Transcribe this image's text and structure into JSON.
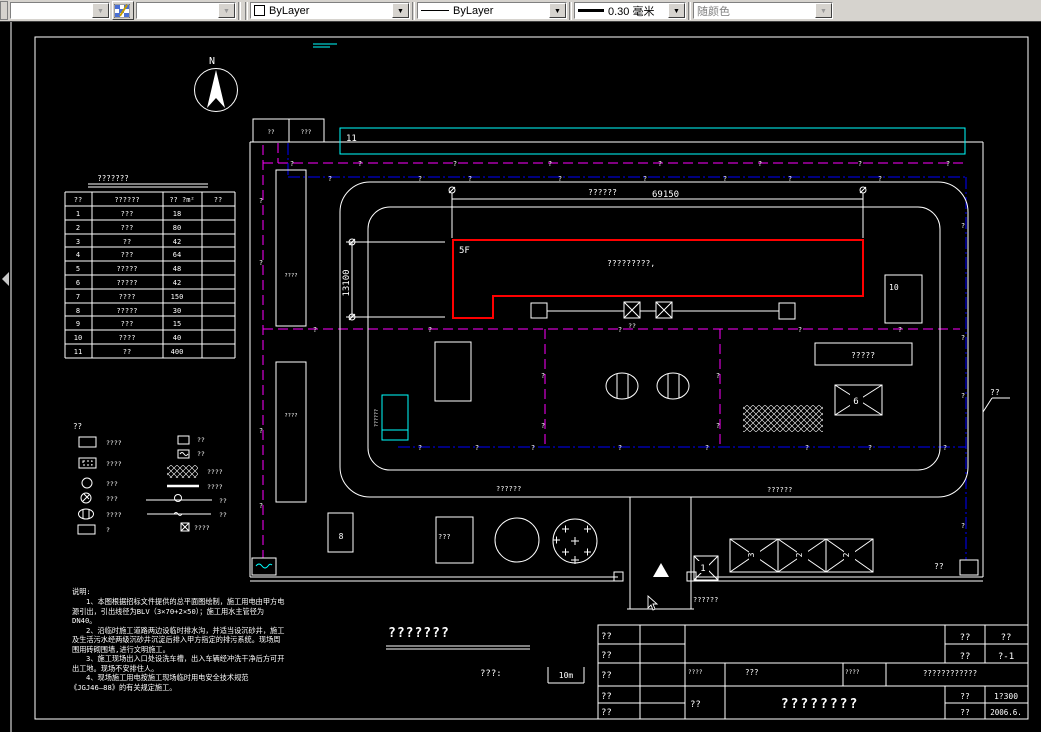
{
  "toolbar": {
    "combo1_value": "",
    "combo2_value": "",
    "color_value": "ByLayer",
    "linetype_value": "ByLayer",
    "lineweight_value": "0.30 毫米",
    "plotstyle_value": "随颜色"
  },
  "colors": {
    "canvas_background": "#000000",
    "drawing_line": "#ffffff",
    "building_outline": "#ff0000",
    "water_pipe_line": "#ff00ff",
    "power_cable_line": "#0000ff",
    "highlight": "#00ffff",
    "toolbar_background": "#d6d3ce"
  },
  "site_table": {
    "title": "???????",
    "headers": [
      "??",
      "??????",
      "?? ?m²",
      "??"
    ],
    "rows": [
      {
        "no": "1",
        "name": "???",
        "area": "18",
        "note": ""
      },
      {
        "no": "2",
        "name": "???",
        "area": "80",
        "note": ""
      },
      {
        "no": "3",
        "name": "??",
        "area": "42",
        "note": ""
      },
      {
        "no": "4",
        "name": "???",
        "area": "64",
        "note": ""
      },
      {
        "no": "5",
        "name": "?????",
        "area": "48",
        "note": ""
      },
      {
        "no": "6",
        "name": "?????",
        "area": "42",
        "note": ""
      },
      {
        "no": "7",
        "name": "????",
        "area": "150",
        "note": ""
      },
      {
        "no": "8",
        "name": "?????",
        "area": "30",
        "note": ""
      },
      {
        "no": "9",
        "name": "???",
        "area": "15",
        "note": ""
      },
      {
        "no": "10",
        "name": "????",
        "area": "40",
        "note": ""
      },
      {
        "no": "11",
        "name": "??",
        "area": "400",
        "note": ""
      }
    ]
  },
  "legend": {
    "title": "??",
    "left": [
      {
        "icon": "rect-outline",
        "label": "????"
      },
      {
        "icon": "rect-dashed-inner",
        "label": "????"
      },
      {
        "icon": "circle-crosshatch",
        "label": "???"
      },
      {
        "icon": "circle-diagonal",
        "label": "???"
      },
      {
        "icon": "ellipse-bars",
        "label": "????"
      },
      {
        "icon": "brick-rect",
        "label": "?"
      }
    ],
    "right": [
      {
        "icon": "hatch-box",
        "label": "??"
      },
      {
        "icon": "wave-box",
        "label": "??"
      },
      {
        "icon": "hatch-area",
        "label": "????"
      },
      {
        "icon": "thick-line",
        "label": "????"
      },
      {
        "icon": "line-circle",
        "label": "??"
      },
      {
        "icon": "line-wave",
        "label": "??"
      },
      {
        "icon": "x-box",
        "label": "????"
      }
    ]
  },
  "plan": {
    "north": "N",
    "box_a": "??",
    "box_b": "???",
    "strip_label": "11",
    "left_bldg1": "????",
    "left_bldg2": "????",
    "dim_road_label": "??????",
    "dim_road_value": "69150",
    "dim_left_value": "13100",
    "bldg_floor": "5F",
    "bldg_name": "?????????,",
    "xbox_label": "??",
    "store_label": "?????",
    "box6": "6",
    "box10": "10",
    "tank_label": "??????",
    "road_label1": "??????",
    "road_label2": "??????",
    "box8": "8",
    "box_small": "???",
    "gate_label": "??????",
    "box1": "1",
    "crane_cells": [
      "3",
      "2",
      "2"
    ],
    "power_label": "??",
    "fence_label": "??",
    "pipe_marker": "?"
  },
  "notes": {
    "lines": [
      "说明:",
      "1、本图根据招标文件提供的总平面图绘制，施工用电由甲方电",
      "源引出，引出线径为BLV（3×70+2×50）；施工用水主管径为",
      "DN40。",
      "2、沿临时施工道路两边设临时排水沟，并适当设沉砂井，施工",
      "及生活污水经两级沉砂井沉淀后排入甲方指定的排污系统。现场周",
      "围用砖砌围墙,进行文明施工。",
      "3、施工现场出入口处设洗车槽，出入车辆经冲洗干净后方可开",
      "出工地。现场不安排住人。",
      "4、现场施工用电按施工现场临时用电安全技术规范",
      "《JGJ46—88》的有关规定施工。"
    ]
  },
  "drawing_title": {
    "text": "???????",
    "scale_label": "???:",
    "bar_label": "10m"
  },
  "title_block": {
    "rows_left": [
      "??",
      "??",
      "??",
      "??",
      "??"
    ],
    "r1a": "??",
    "r1b": "??",
    "r2a": "??",
    "drawing_no": "?-1",
    "r3a": "????",
    "r3b": "???",
    "r3c": "????",
    "r3d": "????????????",
    "span_label": "??",
    "project_title": "????????",
    "scale_label": "??",
    "scale_value": "1?300",
    "date_label": "??",
    "date_value": "2006.6."
  }
}
